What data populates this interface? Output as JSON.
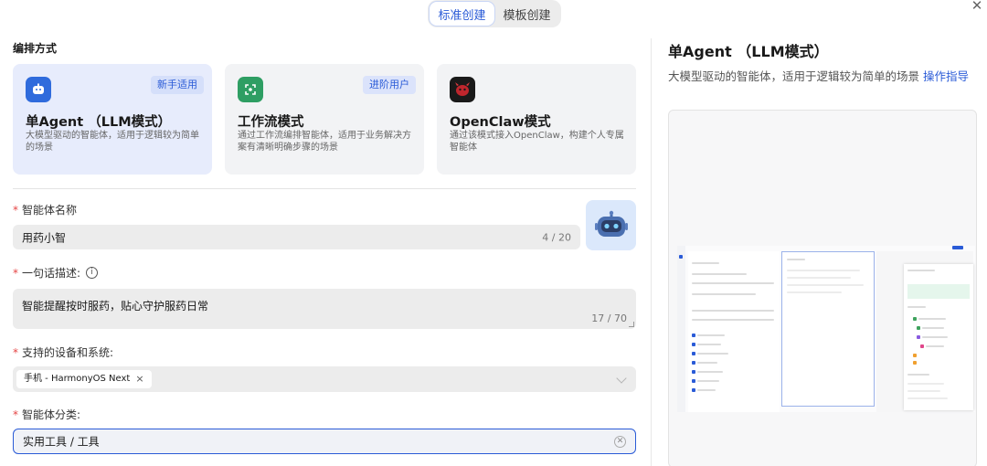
{
  "tabs": [
    {
      "label": "标准创建",
      "active": true
    },
    {
      "label": "模板创建",
      "active": false
    }
  ],
  "section_title": "编排方式",
  "modes": [
    {
      "title": "单Agent （LLM模式）",
      "desc": "大模型驱动的智能体，适用于逻辑较为简单的场景",
      "badge": "新手适用",
      "icon": "robot-face-icon",
      "icon_color": "#2f6bdc",
      "selected": true
    },
    {
      "title": "工作流模式",
      "desc": "通过工作流编排智能体，适用于业务解决方案有清晰明确步骤的场景",
      "badge": "进阶用户",
      "icon": "workflow-icon",
      "icon_color": "#2e9e63",
      "selected": false
    },
    {
      "title": "OpenClaw模式",
      "desc": "通过该模式接入OpenClaw，构建个人专属智能体",
      "badge": "",
      "icon": "claw-icon",
      "icon_color": "#c0262d",
      "selected": false
    }
  ],
  "form": {
    "name_label": "智能体名称",
    "name_value": "用药小智",
    "name_count": "4 / 20",
    "desc_label": "一句话描述:",
    "desc_value": "智能提醒按时服药，贴心守护服药日常",
    "desc_count": "17 / 70",
    "device_label": "支持的设备和系统:",
    "device_tag": "手机 - HarmonyOS Next",
    "device_tag_close": "×",
    "category_label": "智能体分类:",
    "category_value": "实用工具 / 工具",
    "required_mark": "*",
    "info_icon": "info-circle-icon"
  },
  "right": {
    "title": "单Agent （LLM模式）",
    "desc": "大模型驱动的智能体，适用于逻辑较为简单的场景 ",
    "link": "操作指导"
  },
  "colors": {
    "accent": "#2a5bd7",
    "required": "#e54545",
    "card_selected": "#e7ecfc"
  }
}
